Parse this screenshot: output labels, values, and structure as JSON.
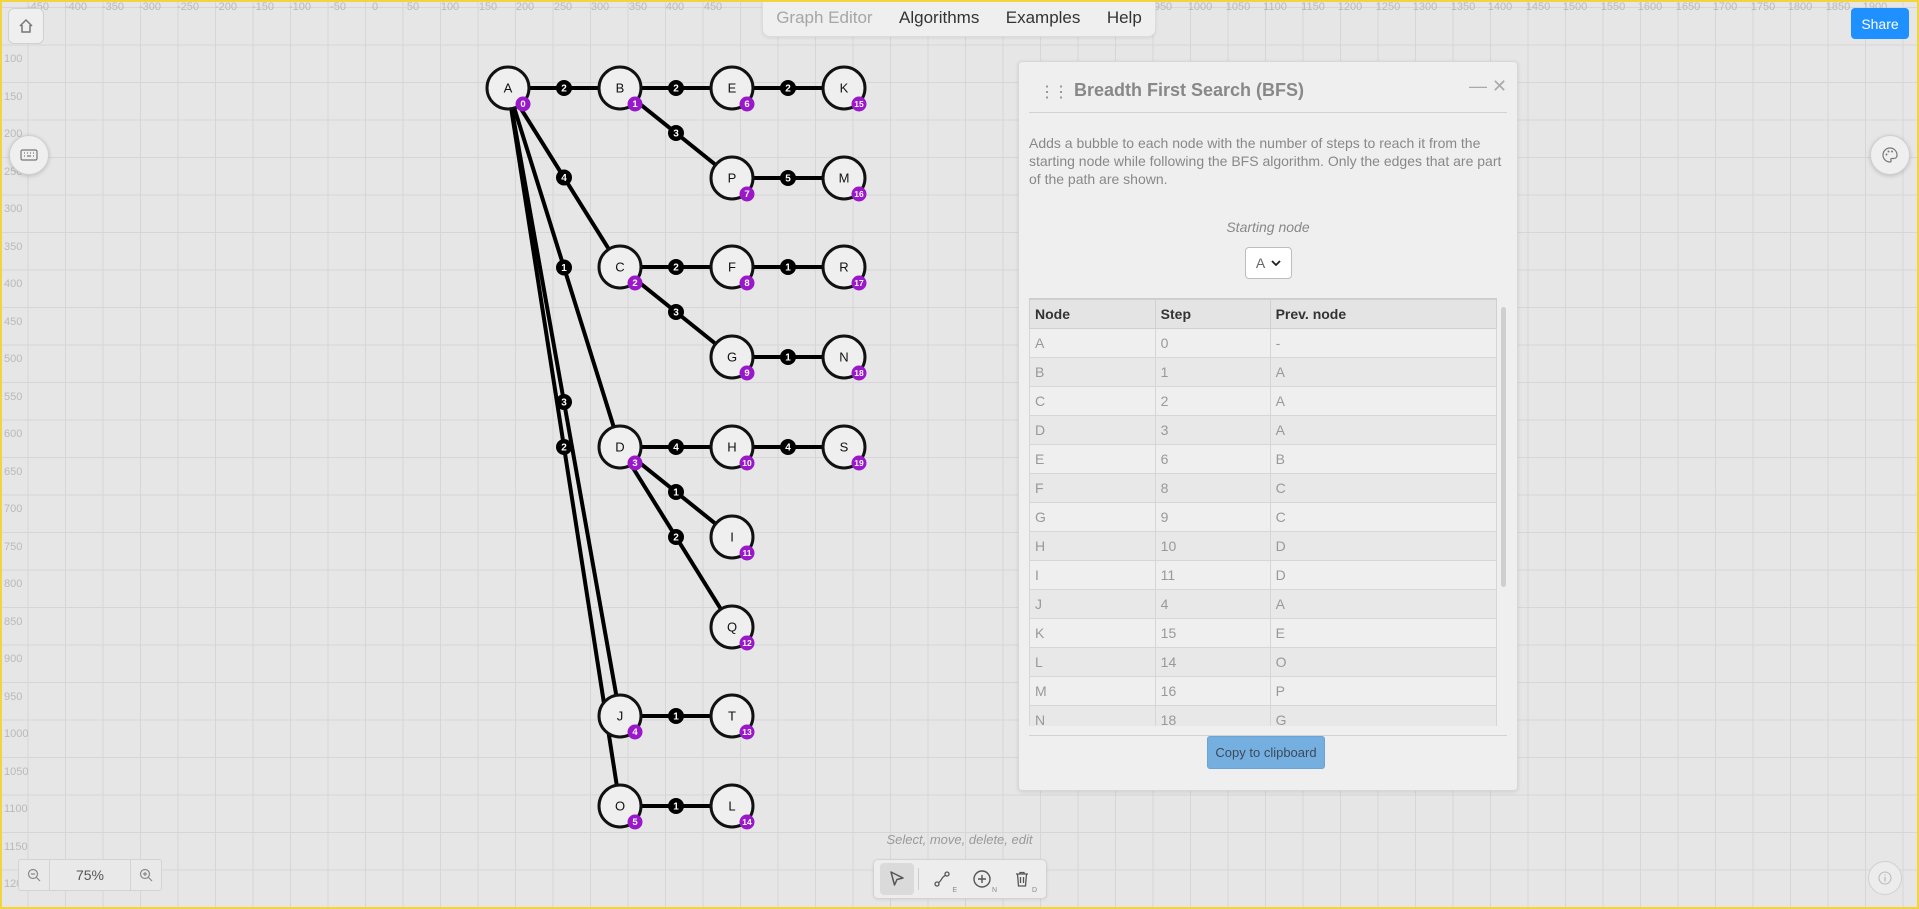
{
  "ruler": {
    "top": [
      "-450",
      "-400",
      "-350",
      "-300",
      "-250",
      "-200",
      "-150",
      "-100",
      "-50",
      "0",
      "50",
      "100",
      "150",
      "200",
      "250",
      "300",
      "350",
      "400",
      "450",
      "950",
      "1000",
      "1050",
      "1100",
      "1150",
      "1200",
      "1250",
      "1300",
      "1350",
      "1400",
      "1450",
      "1500",
      "1550",
      "1600",
      "1650",
      "1700",
      "1750",
      "1800",
      "1850",
      "1900"
    ],
    "left": [
      "100",
      "150",
      "200",
      "250",
      "300",
      "350",
      "400",
      "450",
      "500",
      "550",
      "600",
      "650",
      "700",
      "750",
      "800",
      "850",
      "900",
      "950",
      "1000",
      "1050",
      "1100",
      "1150",
      "1200"
    ]
  },
  "menubar": {
    "graph_editor": "Graph Editor",
    "algorithms": "Algorithms",
    "examples": "Examples",
    "help": "Help"
  },
  "share_label": "Share",
  "graph": {
    "nodes": [
      {
        "id": "A",
        "step": "0"
      },
      {
        "id": "B",
        "step": "1"
      },
      {
        "id": "E",
        "step": "6"
      },
      {
        "id": "K",
        "step": "15"
      },
      {
        "id": "P",
        "step": "7"
      },
      {
        "id": "M",
        "step": "16"
      },
      {
        "id": "C",
        "step": "2"
      },
      {
        "id": "F",
        "step": "8"
      },
      {
        "id": "R",
        "step": "17"
      },
      {
        "id": "G",
        "step": "9"
      },
      {
        "id": "N",
        "step": "18"
      },
      {
        "id": "D",
        "step": "3"
      },
      {
        "id": "H",
        "step": "10"
      },
      {
        "id": "S",
        "step": "19"
      },
      {
        "id": "I",
        "step": "11"
      },
      {
        "id": "Q",
        "step": "12"
      },
      {
        "id": "J",
        "step": "4"
      },
      {
        "id": "T",
        "step": "13"
      },
      {
        "id": "O",
        "step": "5"
      },
      {
        "id": "L",
        "step": "14"
      }
    ],
    "edges": [
      {
        "from": "A",
        "to": "B",
        "weight": "2"
      },
      {
        "from": "B",
        "to": "E",
        "weight": "2"
      },
      {
        "from": "E",
        "to": "K",
        "weight": "2"
      },
      {
        "from": "B",
        "to": "P",
        "weight": "3"
      },
      {
        "from": "P",
        "to": "M",
        "weight": "5"
      },
      {
        "from": "A",
        "to": "C",
        "weight": "4"
      },
      {
        "from": "C",
        "to": "F",
        "weight": "2"
      },
      {
        "from": "F",
        "to": "R",
        "weight": "1"
      },
      {
        "from": "C",
        "to": "G",
        "weight": "3"
      },
      {
        "from": "G",
        "to": "N",
        "weight": "1"
      },
      {
        "from": "A",
        "to": "D",
        "weight": "1"
      },
      {
        "from": "D",
        "to": "H",
        "weight": "4"
      },
      {
        "from": "H",
        "to": "S",
        "weight": "4"
      },
      {
        "from": "D",
        "to": "I",
        "weight": "1"
      },
      {
        "from": "D",
        "to": "Q",
        "weight": "2"
      },
      {
        "from": "A",
        "to": "J",
        "weight": "3"
      },
      {
        "from": "J",
        "to": "T",
        "weight": "1"
      },
      {
        "from": "A",
        "to": "O",
        "weight": "2"
      },
      {
        "from": "O",
        "to": "L",
        "weight": "1"
      }
    ]
  },
  "panel": {
    "title": "Breadth First Search (BFS)",
    "minimize": "—",
    "close": "✕",
    "description": "Adds a bubble to each node with the number of steps to reach it from the starting node while following the BFS algorithm. Only the edges that are part of the path are shown.",
    "starting_node_label": "Starting node",
    "starting_node_value": "A",
    "table_headers": [
      "Node",
      "Step",
      "Prev. node"
    ],
    "table_rows": [
      [
        "A",
        "0",
        "-"
      ],
      [
        "B",
        "1",
        "A"
      ],
      [
        "C",
        "2",
        "A"
      ],
      [
        "D",
        "3",
        "A"
      ],
      [
        "E",
        "6",
        "B"
      ],
      [
        "F",
        "8",
        "C"
      ],
      [
        "G",
        "9",
        "C"
      ],
      [
        "H",
        "10",
        "D"
      ],
      [
        "I",
        "11",
        "D"
      ],
      [
        "J",
        "4",
        "A"
      ],
      [
        "K",
        "15",
        "E"
      ],
      [
        "L",
        "14",
        "O"
      ],
      [
        "M",
        "16",
        "P"
      ],
      [
        "N",
        "18",
        "G"
      ]
    ],
    "copy_label": "Copy to clipboard"
  },
  "zoom": {
    "value": "75%"
  },
  "tool_hint": "Select, move, delete, edit",
  "tools": [
    {
      "name": "select-tool",
      "shortcut": ""
    },
    {
      "name": "edge-tool",
      "shortcut": "E"
    },
    {
      "name": "add-node-tool",
      "shortcut": "N"
    },
    {
      "name": "delete-tool",
      "shortcut": "D"
    }
  ],
  "colors": {
    "accent": "#1e90ff",
    "bubble": "#9a18c9",
    "edge": "#000000",
    "node_fill": "#efefef"
  },
  "icons": {
    "home": "home-icon",
    "keyboard": "keyboard-icon",
    "palette": "palette-icon",
    "info": "info-icon"
  }
}
